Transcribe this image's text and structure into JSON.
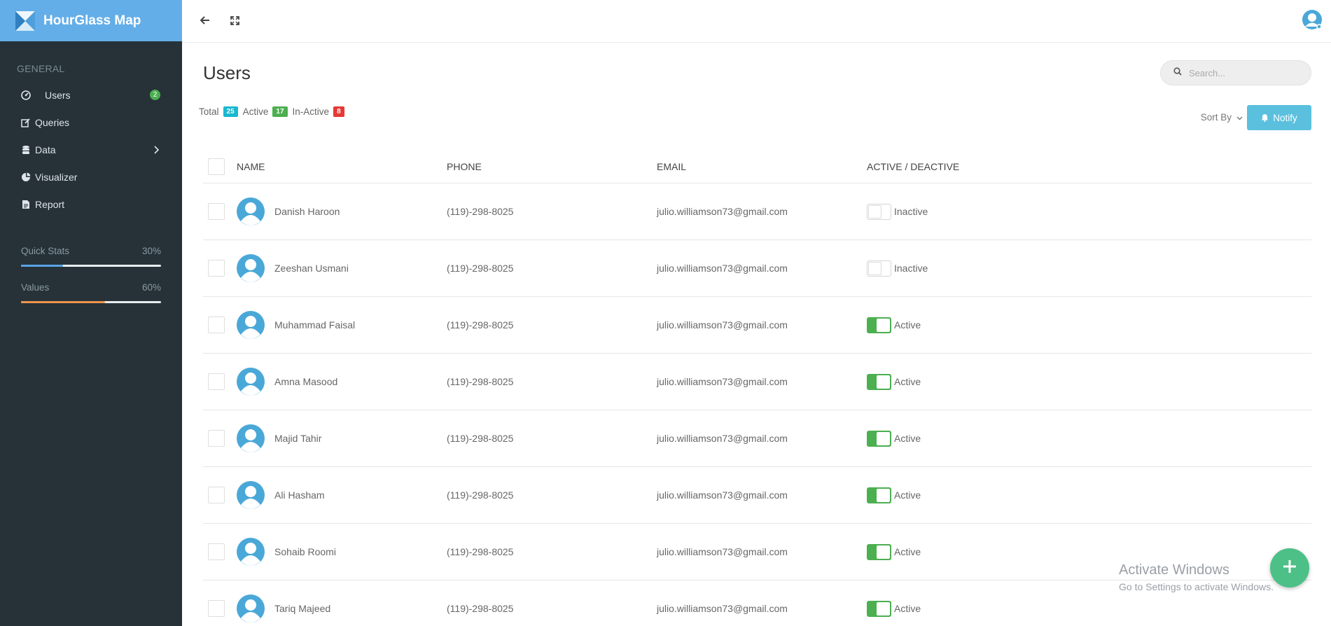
{
  "app": {
    "title": "HourGlass Map"
  },
  "sidebar": {
    "section_label": "GENERAL",
    "items": [
      {
        "label": "Users",
        "icon": "gauge-icon",
        "badge": "2"
      },
      {
        "label": "Queries",
        "icon": "edit-icon"
      },
      {
        "label": "Data",
        "icon": "database-icon"
      },
      {
        "label": "Visualizer",
        "icon": "pie-chart-icon"
      },
      {
        "label": "Report",
        "icon": "file-text-icon"
      }
    ],
    "stats": [
      {
        "label": "Quick Stats",
        "value": "30%",
        "color": "#5aa3e6",
        "fraction": 0.3
      },
      {
        "label": "Values",
        "value": "60%",
        "color": "#f0954d",
        "fraction": 0.6
      }
    ]
  },
  "page": {
    "title": "Users",
    "search_placeholder": "Search...",
    "counts": {
      "total_label": "Total",
      "total": "25",
      "total_color": "#1ab7d0",
      "active_label": "Active",
      "active": "17",
      "active_color": "#4caf50",
      "inactive_label": "In-Active",
      "inactive": "8",
      "inactive_color": "#e53935"
    },
    "sort_label": "Sort By",
    "notify_label": "Notify"
  },
  "table": {
    "headers": {
      "name": "NAME",
      "phone": "PHONE",
      "email": "EMAIL",
      "status": "ACTIVE / DEACTIVE"
    },
    "rows": [
      {
        "name": "Danish Haroon",
        "phone": "(119)-298-8025",
        "email": "julio.williamson73@gmail.com",
        "status": "Inactive",
        "active": false
      },
      {
        "name": "Zeeshan Usmani",
        "phone": "(119)-298-8025",
        "email": "julio.williamson73@gmail.com",
        "status": "Inactive",
        "active": false
      },
      {
        "name": "Muhammad Faisal",
        "phone": "(119)-298-8025",
        "email": "julio.williamson73@gmail.com",
        "status": "Active",
        "active": true
      },
      {
        "name": "Amna Masood",
        "phone": "(119)-298-8025",
        "email": "julio.williamson73@gmail.com",
        "status": "Active",
        "active": true
      },
      {
        "name": "Majid Tahir",
        "phone": "(119)-298-8025",
        "email": "julio.williamson73@gmail.com",
        "status": "Active",
        "active": true
      },
      {
        "name": "Ali Hasham",
        "phone": "(119)-298-8025",
        "email": "julio.williamson73@gmail.com",
        "status": "Active",
        "active": true
      },
      {
        "name": "Sohaib Roomi",
        "phone": "(119)-298-8025",
        "email": "julio.williamson73@gmail.com",
        "status": "Active",
        "active": true
      },
      {
        "name": "Tariq Majeed",
        "phone": "(119)-298-8025",
        "email": "julio.williamson73@gmail.com",
        "status": "Active",
        "active": true
      }
    ]
  },
  "watermark": {
    "line1": "Activate Windows",
    "line2": "Go to Settings to activate Windows."
  },
  "colors": {
    "brand": "#63aee8",
    "sidebar": "#263238",
    "accent": "#5bc0de",
    "fab": "#4cc087",
    "toggle_on": "#4caf50"
  }
}
